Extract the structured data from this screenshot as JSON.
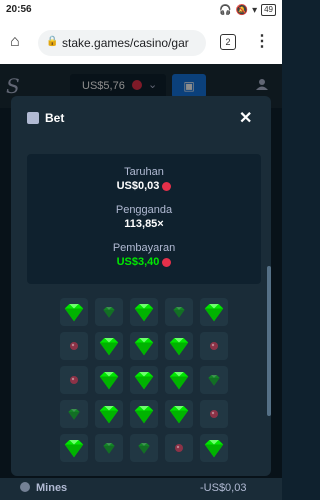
{
  "status": {
    "time": "20:56",
    "battery": "49"
  },
  "browser": {
    "url": "stake.games/casino/gar",
    "tab_count": "2"
  },
  "header": {
    "balance": "US$5,76"
  },
  "modal": {
    "title": "Bet",
    "bet_label": "Taruhan",
    "bet_value": "US$0,03",
    "multiplier_label": "Pengganda",
    "multiplier_value": "113,85×",
    "payout_label": "Pembayaran",
    "payout_value": "US$3,40"
  },
  "grid": [
    [
      "gem",
      "gem-dim",
      "gem",
      "gem-dim",
      "gem"
    ],
    [
      "mine",
      "gem",
      "gem",
      "gem",
      "mine"
    ],
    [
      "mine",
      "gem",
      "gem",
      "gem",
      "gem-dim"
    ],
    [
      "gem-dim",
      "gem",
      "gem",
      "gem",
      "mine"
    ],
    [
      "gem",
      "gem-dim",
      "gem-dim",
      "mine",
      "gem"
    ]
  ],
  "footer": {
    "mines_label": "Mines",
    "amount": "-US$0,03"
  },
  "colors": {
    "gem": "#00e701",
    "mine": "#e5304a",
    "accent": "#1475e1"
  }
}
